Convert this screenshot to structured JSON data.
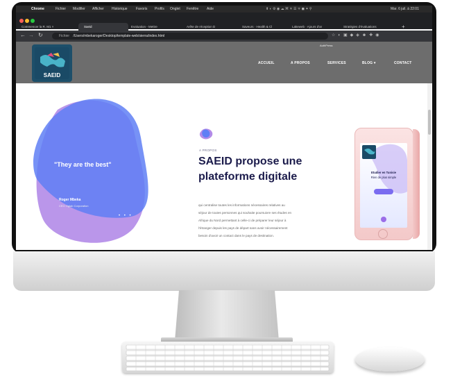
{
  "menubar": {
    "apple": "",
    "app": "Chrome",
    "items": [
      "Fichier",
      "Modifier",
      "Afficher",
      "Historique",
      "Favoris",
      "Profils",
      "Onglet",
      "Fenêtre",
      "Aide"
    ],
    "datetime": "Mar. 6 juil. à 22:01"
  },
  "browser": {
    "tabs": [
      {
        "label": "Commencer la R. M1 ×"
      },
      {
        "label": "Saeid",
        "active": true
      },
      {
        "label": "Evaluation - Mettre"
      },
      {
        "label": "Arête de réception D"
      },
      {
        "label": "Saveurs · Health & Cl"
      },
      {
        "label": "Lakeweb · Ajours d'ar"
      },
      {
        "label": "Stratégies d'évaluations"
      }
    ],
    "url_prefix": "Fichier",
    "url": "/Users/mbekaroger/Desktop/template-web/sierra/index.html",
    "close_glyph": "×",
    "new_tab": "+"
  },
  "site": {
    "logo_text": "SAEID",
    "top_small": "AuthPress",
    "nav": [
      "ACCUEIL",
      "A PROPOS",
      "SERVICES",
      "BLOG ▾",
      "CONTACT"
    ],
    "quote": "\"They are the best\"",
    "author_name": "Roger Mbeka",
    "author_company": "CEO Oglab Corporation",
    "eyebrow": "A PROPOS",
    "headline_line1": "SAEID propose une",
    "headline_line2": "plateforme digitale",
    "body": [
      "qui centralise toutes les informations nécessaires relatives au",
      "séjour de toutes personnes qui souhaite poursuivre ses études en",
      "Afrique du Nord permettant à celle-ci de préparer leur séjour à",
      "l'étranger depuis les pays de départ sans avoir nécessairement",
      "besoin d'avoir un contact dans le pays de destination."
    ],
    "phone_text1": "Etudier en Tunisie",
    "phone_text2": "Rien de plus simple",
    "phone_logo": "SAEID"
  },
  "colors": {
    "blob_blue": "#5f7ff5",
    "blob_purple": "#b38be8",
    "header_grey": "#6d6d6d",
    "headline": "#1b1b4b"
  }
}
